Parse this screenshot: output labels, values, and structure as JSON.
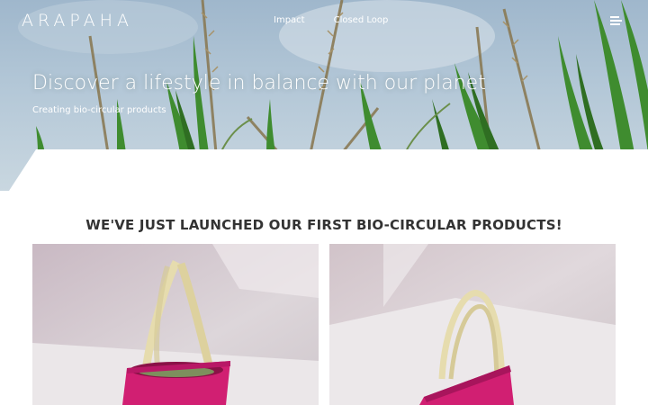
{
  "header": {
    "brand": "ARAPAHA",
    "nav": [
      {
        "label": "Impact"
      },
      {
        "label": "Closed Loop"
      }
    ],
    "menu_icon": "hamburger-menu-icon"
  },
  "hero": {
    "headline": "Discover a lifestyle in balance with our planet",
    "subheadline": "Creating bio-circular products"
  },
  "section": {
    "title": "WE'VE JUST LAUNCHED OUR FIRST BIO-CIRCULAR PRODUCTS!"
  },
  "products": [
    {
      "image": "pink tote bag with cream handles"
    },
    {
      "image": "pink tote bag with cream handles"
    }
  ],
  "colors": {
    "brand_text": "#ffffff",
    "sky": "#b3c7d7",
    "grass": "#3f8c2f",
    "tote_pink": "#d11f72",
    "handle_cream": "#e8dfb0"
  }
}
